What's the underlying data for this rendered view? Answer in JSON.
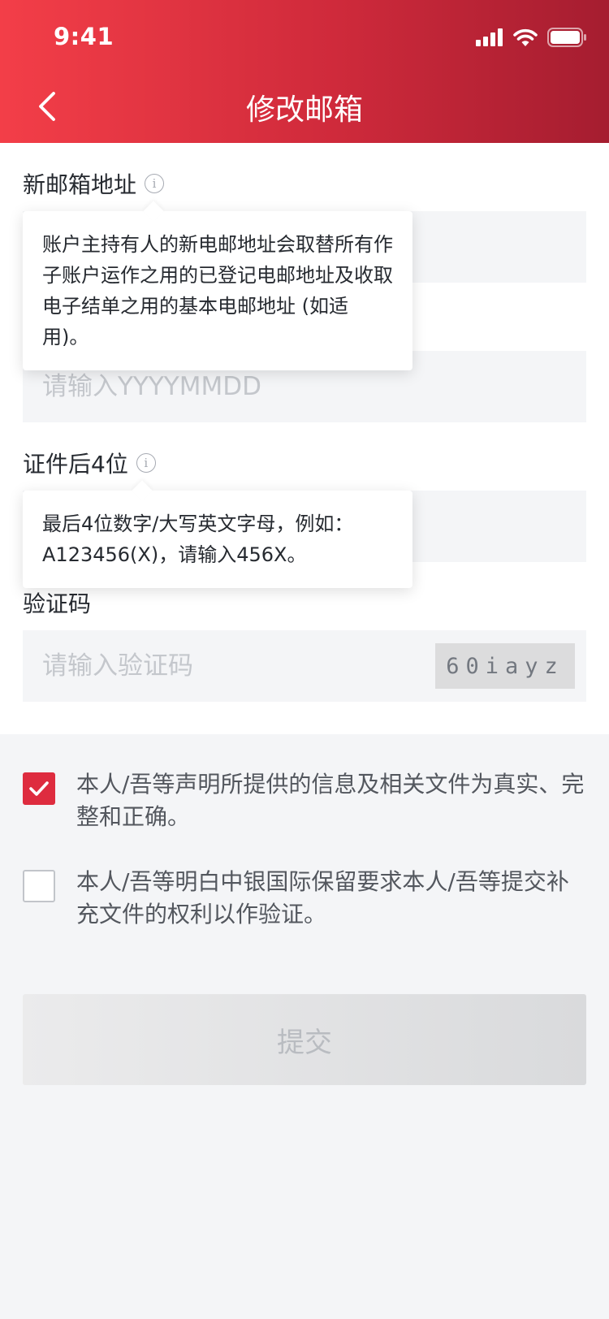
{
  "status_bar": {
    "time": "9:41",
    "icons": [
      "cellular-signal-icon",
      "wifi-icon",
      "battery-icon"
    ]
  },
  "nav": {
    "back_icon": "chevron-left-icon",
    "title": "修改邮箱"
  },
  "form": {
    "email": {
      "label": "新邮箱地址",
      "value": "",
      "placeholder": "",
      "tooltip": "账户主持有人的新电邮地址会取替所有作子账户运作之用的已登记电邮地址及收取电子结单之用的基本电邮地址 (如适用)。"
    },
    "dob": {
      "value": "",
      "placeholder": "请输入YYYYMMDD"
    },
    "id_last4": {
      "label": "证件后4位",
      "value": "",
      "placeholder": "",
      "tooltip": "最后4位数字/大写英文字母，例如：A123456(X)，请输入456X。"
    },
    "captcha": {
      "label": "验证码",
      "value": "",
      "placeholder": "请输入验证码",
      "code": "60iayz"
    }
  },
  "consents": [
    {
      "checked": true,
      "text": "本人/吾等声明所提供的信息及相关文件为真实、完整和正确。"
    },
    {
      "checked": false,
      "text": "本人/吾等明白中银国际保留要求本人/吾等提交补充文件的权利以作验证。"
    }
  ],
  "submit": {
    "label": "提交",
    "enabled": false
  },
  "colors": {
    "brand_gradient_start": "#f33e48",
    "brand_gradient_end": "#a51d30",
    "checkbox_checked": "#de2c3f",
    "input_background": "#f4f5f7"
  }
}
